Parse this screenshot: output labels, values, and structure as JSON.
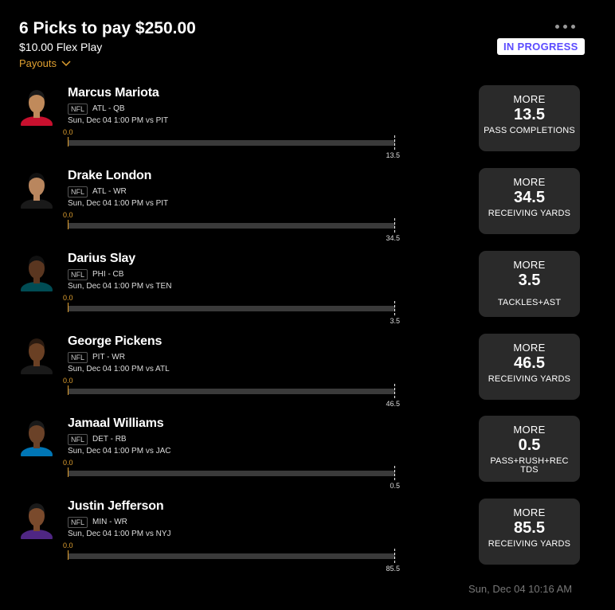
{
  "header": {
    "title": "6 Picks to pay $250.00",
    "subtitle": "$10.00 Flex Play",
    "payouts_label": "Payouts",
    "status": "IN PROGRESS",
    "status_color": "#5b4bff",
    "accent_color": "#e0a030"
  },
  "picks": [
    {
      "player": "Marcus Mariota",
      "league": "NFL",
      "team_pos": "ATL - QB",
      "game": "Sun, Dec 04 1:00 PM  vs PIT",
      "bar_min": "0.0",
      "bar_max": "13.5",
      "progress": 0.0,
      "direction": "MORE",
      "line": "13.5",
      "stat": "PASS COMPLETIONS",
      "avatar_skin": "#c08a5b",
      "avatar_hair": "#1a1a1a",
      "avatar_shirt": "#c8102e"
    },
    {
      "player": "Drake London",
      "league": "NFL",
      "team_pos": "ATL - WR",
      "game": "Sun, Dec 04 1:00 PM  vs PIT",
      "bar_min": "0.0",
      "bar_max": "34.5",
      "progress": 0.0,
      "direction": "MORE",
      "line": "34.5",
      "stat": "RECEIVING YARDS",
      "avatar_skin": "#b9865e",
      "avatar_hair": "#111111",
      "avatar_shirt": "#1a1a1a"
    },
    {
      "player": "Darius Slay",
      "league": "NFL",
      "team_pos": "PHI - CB",
      "game": "Sun, Dec 04 1:00 PM  vs TEN",
      "bar_min": "0.0",
      "bar_max": "3.5",
      "progress": 0.0,
      "direction": "MORE",
      "line": "3.5",
      "stat": "TACKLES+AST",
      "avatar_skin": "#5a3620",
      "avatar_hair": "#111111",
      "avatar_shirt": "#004c54"
    },
    {
      "player": "George Pickens",
      "league": "NFL",
      "team_pos": "PIT - WR",
      "game": "Sun, Dec 04 1:00 PM  vs ATL",
      "bar_min": "0.0",
      "bar_max": "46.5",
      "progress": 0.0,
      "direction": "MORE",
      "line": "46.5",
      "stat": "RECEIVING YARDS",
      "avatar_skin": "#6a4024",
      "avatar_hair": "#2a1a10",
      "avatar_shirt": "#1a1a1a"
    },
    {
      "player": "Jamaal Williams",
      "league": "NFL",
      "team_pos": "DET - RB",
      "game": "Sun, Dec 04 1:00 PM  vs JAC",
      "bar_min": "0.0",
      "bar_max": "0.5",
      "progress": 0.0,
      "direction": "MORE",
      "line": "0.5",
      "stat": "PASS+RUSH+REC TDS",
      "avatar_skin": "#6b4228",
      "avatar_hair": "#1a1a1a",
      "avatar_shirt": "#0076b6"
    },
    {
      "player": "Justin Jefferson",
      "league": "NFL",
      "team_pos": "MIN - WR",
      "game": "Sun, Dec 04 1:00 PM  vs NYJ",
      "bar_min": "0.0",
      "bar_max": "85.5",
      "progress": 0.0,
      "direction": "MORE",
      "line": "85.5",
      "stat": "RECEIVING YARDS",
      "avatar_skin": "#7a4a2c",
      "avatar_hair": "#1a1a1a",
      "avatar_shirt": "#4f2683"
    }
  ],
  "footer": {
    "timestamp": "Sun, Dec 04 10:16 AM"
  }
}
